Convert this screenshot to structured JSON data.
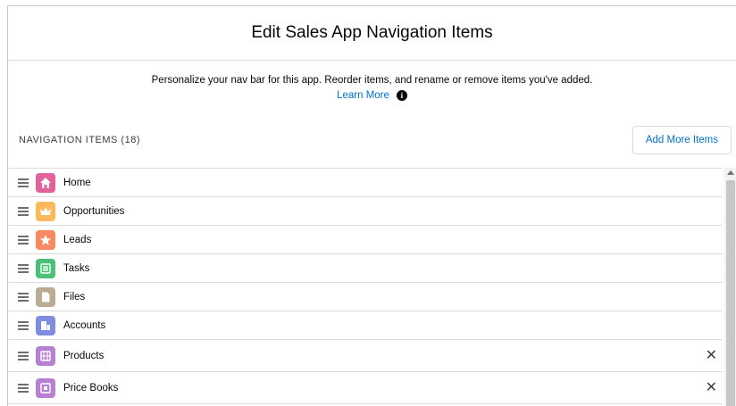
{
  "modal": {
    "title": "Edit Sales App Navigation Items",
    "intro": "Personalize your nav bar for this app. Reorder items, and rename or remove items you've added.",
    "learn_more": "Learn More",
    "info_icon": "i"
  },
  "section": {
    "label": "NAVIGATION ITEMS (18)",
    "add_button": "Add More Items"
  },
  "items": [
    {
      "label": "Home",
      "icon": "home-icon",
      "color": "#e3629c"
    },
    {
      "label": "Opportunities",
      "icon": "crown-icon",
      "color": "#fcb95b"
    },
    {
      "label": "Leads",
      "icon": "star-icon",
      "color": "#f88962"
    },
    {
      "label": "Tasks",
      "icon": "checklist-icon",
      "color": "#4bc076"
    },
    {
      "label": "Files",
      "icon": "file-icon",
      "color": "#baac93"
    },
    {
      "label": "Accounts",
      "icon": "account-icon",
      "color": "#7f8de1"
    },
    {
      "label": "Products",
      "icon": "product-icon",
      "color": "#b781d3"
    },
    {
      "label": "Price Books",
      "icon": "pricebook-icon",
      "color": "#b781d3"
    }
  ],
  "remove_glyph": "✕"
}
